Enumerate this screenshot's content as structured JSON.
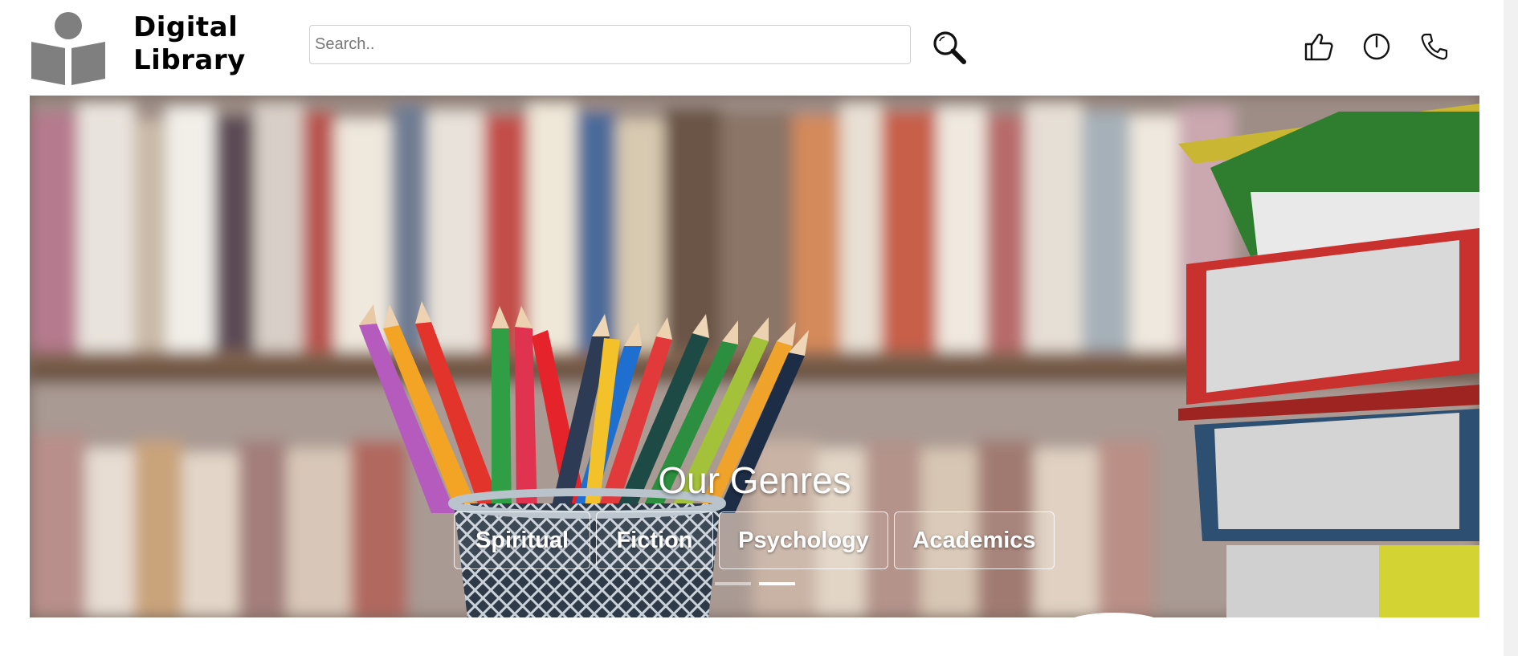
{
  "header": {
    "brand_line1": "Digital",
    "brand_line2": "Library",
    "search": {
      "placeholder": "Search..",
      "value": ""
    },
    "icons": [
      "thumbs-up-icon",
      "power-icon",
      "phone-icon"
    ]
  },
  "hero": {
    "title": "Our Genres",
    "genres": [
      "Spiritual",
      "Fiction",
      "Psychology",
      "Academics"
    ],
    "carousel": {
      "slides": 2,
      "active_index": 1
    }
  },
  "colors": {
    "logo_gray": "#7f7f7f",
    "text_white": "#ffffff"
  }
}
